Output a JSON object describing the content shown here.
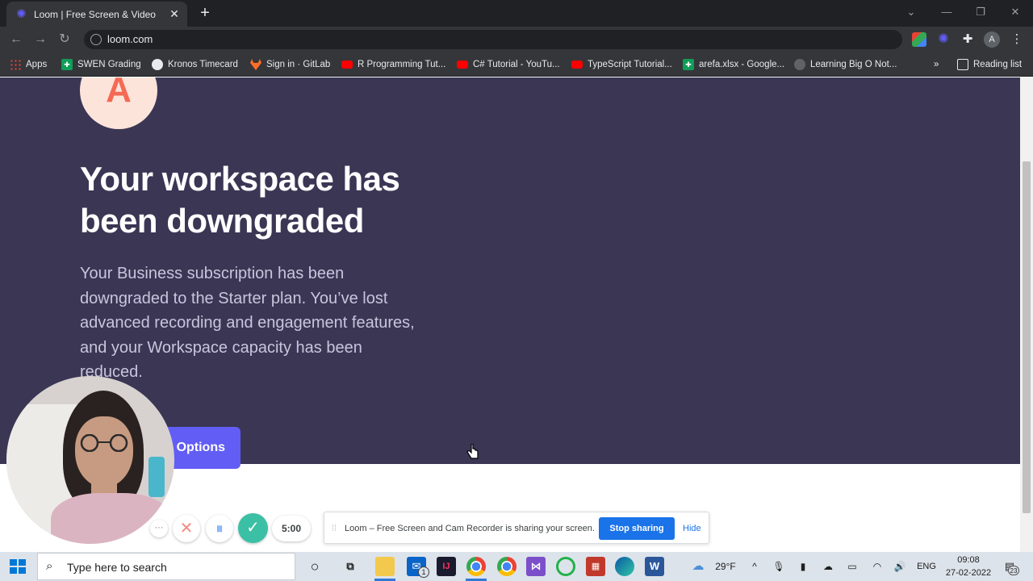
{
  "browser": {
    "tab": {
      "title": "Loom | Free Screen & Video Recording",
      "close": "✕",
      "icon": "loom-star-icon"
    },
    "new_tab": "+",
    "window_controls": {
      "tab_search": "⌄",
      "minimize": "—",
      "restore": "❐",
      "close": "✕"
    },
    "url": "loom.com",
    "profile_initial": "A",
    "bookmarks": [
      {
        "label": "Apps",
        "icon": "apps-grid-icon"
      },
      {
        "label": "SWEN Grading",
        "icon": "sheets-icon"
      },
      {
        "label": "Kronos Timecard",
        "icon": "kronos-icon"
      },
      {
        "label": "Sign in · GitLab",
        "icon": "gitlab-icon"
      },
      {
        "label": "R Programming Tut...",
        "icon": "youtube-icon"
      },
      {
        "label": "C# Tutorial - YouTu...",
        "icon": "youtube-icon"
      },
      {
        "label": "TypeScript Tutorial...",
        "icon": "youtube-icon"
      },
      {
        "label": "arefa.xlsx - Google...",
        "icon": "sheets-icon"
      },
      {
        "label": "Learning Big O Not...",
        "icon": "globe-icon"
      }
    ],
    "bookmarks_overflow": "»",
    "reading_list": "Reading list"
  },
  "page": {
    "avatar_initial": "A",
    "headline": "Your workspace has been downgraded",
    "body": "Your Business subscription has been downgraded to the Starter plan. You’ve lost advanced recording and engagement features, and your Workspace capacity has been reduced.",
    "options_button": "Options",
    "colors": {
      "hero_bg": "#3a3654",
      "accent": "#625df5",
      "avatar_bg": "#fde4da",
      "avatar_fg": "#f46a55"
    }
  },
  "loom_controls": {
    "more": "···",
    "cancel": "✕",
    "pause": "⏸",
    "done": "✓",
    "timer": "5:00"
  },
  "share_bar": {
    "message": "Loom – Free Screen and Cam Recorder is sharing your screen.",
    "stop_button": "Stop sharing",
    "hide_link": "Hide"
  },
  "taskbar": {
    "search_placeholder": "Type here to search",
    "weather": "29°F",
    "language": "ENG",
    "time": "09:08",
    "date": "27-02-2022",
    "notification_count": "23",
    "mail_badge": "1"
  }
}
